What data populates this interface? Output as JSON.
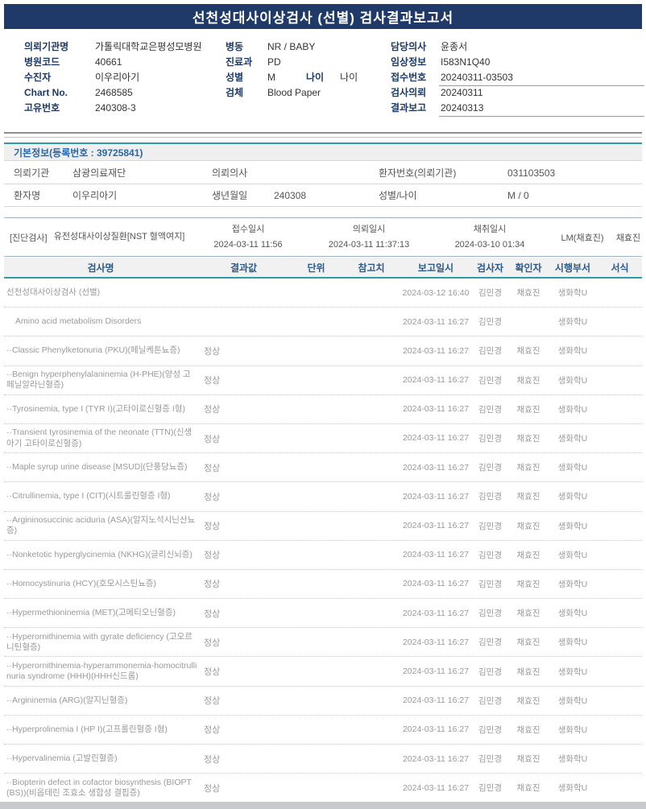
{
  "title": "선천성대사이상검사 (선별) 검사결과보고서",
  "patient_header": {
    "col1": [
      {
        "label": "의뢰기관명",
        "value": "가톨릭대학교은평성모병원"
      },
      {
        "label": "병원코드",
        "value": "40661"
      },
      {
        "label": "수진자",
        "value": "이우리아기"
      },
      {
        "label": "Chart No.",
        "value": "2468585"
      },
      {
        "label": "고유번호",
        "value": "240308-3"
      }
    ],
    "col2": [
      {
        "label": "병동",
        "value": "NR / BABY"
      },
      {
        "label": "진료과",
        "value": "PD"
      },
      {
        "label": "성별",
        "value": "M",
        "label2": "나이",
        "value2": "나이"
      },
      {
        "label": "검체",
        "value": "Blood Paper"
      }
    ],
    "col3": [
      {
        "label": "담당의사",
        "value": "윤종서"
      },
      {
        "label": "임상정보",
        "value": "I583N1Q40"
      },
      {
        "label": "접수번호",
        "value": "20240311-03503",
        "underline": true
      },
      {
        "label": "검사의뢰",
        "value": "20240311"
      },
      {
        "label": "결과보고",
        "value": "20240313",
        "underline": true
      }
    ]
  },
  "basic_info": {
    "header": "기본정보(등록번호 : 39725841)",
    "rows": [
      [
        {
          "label": "의뢰기관",
          "value": "삼광의료재단"
        },
        {
          "label": "의뢰의사",
          "value": ""
        },
        {
          "label": "환자번호(의뢰기관)",
          "value": "031103503"
        }
      ],
      [
        {
          "label": "환자명",
          "value": "이우리아기"
        },
        {
          "label": "생년월일",
          "value": "240308"
        },
        {
          "label": "성별/나이",
          "value": "M / 0"
        }
      ]
    ]
  },
  "diagnosis": {
    "category": "[진단검사]",
    "test_name": "유전성대사이상질환[NST 혈액여지]",
    "times": [
      {
        "label": "접수일시",
        "value": "2024-03-11 11:56"
      },
      {
        "label": "의뢰일시",
        "value": "2024-03-11 11:37:13"
      },
      {
        "label": "채취일시",
        "value": "2024-03-10 01:34"
      }
    ],
    "lm": "LM(채효진)",
    "collector": "채효진"
  },
  "results_table": {
    "headers": [
      "검사명",
      "결과값",
      "단위",
      "참고치",
      "보고일시",
      "검사자",
      "확인자",
      "시행부서",
      "서식"
    ],
    "rows": [
      {
        "name": "선천성대사이상검사 (선별)",
        "result": "",
        "unit": "",
        "ref": "",
        "reported": "2024-03-12 16:40",
        "tester": "김민경",
        "confirmer": "채효진",
        "dept": "생화학U",
        "form": "",
        "indent": 0
      },
      {
        "name": "Amino acid metabolism Disorders",
        "result": "",
        "unit": "",
        "ref": "",
        "reported": "2024-03-11 16:27",
        "tester": "김민경",
        "confirmer": "",
        "dept": "생화학U",
        "form": "",
        "indent": 1
      },
      {
        "name": "··Classic Phenylketonuria (PKU)(페닐케톤뇨증)",
        "result": "정상",
        "unit": "",
        "ref": "",
        "reported": "2024-03-11 16:27",
        "tester": "김민경",
        "confirmer": "채효진",
        "dept": "생화학U",
        "form": "",
        "indent": 0
      },
      {
        "name": "··Benign hyperphenylalaninemia (H-PHE)(양성 고페닐알라닌혈증)",
        "result": "정상",
        "unit": "",
        "ref": "",
        "reported": "2024-03-11 16:27",
        "tester": "김민경",
        "confirmer": "채효진",
        "dept": "생화학U",
        "form": "",
        "indent": 0
      },
      {
        "name": "··Tyrosinemia, type I (TYR I)(고타이로신혈증 I형)",
        "result": "정상",
        "unit": "",
        "ref": "",
        "reported": "2024-03-11 16:27",
        "tester": "김민경",
        "confirmer": "채효진",
        "dept": "생화학U",
        "form": "",
        "indent": 0
      },
      {
        "name": "··Transient tyrosinemia of the neonate (TTN)(신생아기 고타이로신혈증)",
        "result": "정상",
        "unit": "",
        "ref": "",
        "reported": "2024-03-11 16:27",
        "tester": "김민경",
        "confirmer": "채효진",
        "dept": "생화학U",
        "form": "",
        "indent": 0
      },
      {
        "name": "··Maple syrup urine disease [MSUD](단풍당뇨증)",
        "result": "정상",
        "unit": "",
        "ref": "",
        "reported": "2024-03-11 16:27",
        "tester": "김민경",
        "confirmer": "채효진",
        "dept": "생화학U",
        "form": "",
        "indent": 0
      },
      {
        "name": "··Citrullinemia, type I (CIT)(시트룰린혈증 I형)",
        "result": "정상",
        "unit": "",
        "ref": "",
        "reported": "2024-03-11 16:27",
        "tester": "김민경",
        "confirmer": "채효진",
        "dept": "생화학U",
        "form": "",
        "indent": 0
      },
      {
        "name": "··Argininosuccinic aciduria (ASA)(알지노석시닌산뇨증)",
        "result": "정상",
        "unit": "",
        "ref": "",
        "reported": "2024-03-11 16:27",
        "tester": "김민경",
        "confirmer": "채효진",
        "dept": "생화학U",
        "form": "",
        "indent": 0
      },
      {
        "name": "··Nonketotic hyperglycinemia (NKHG)(글리신뇌증)",
        "result": "정상",
        "unit": "",
        "ref": "",
        "reported": "2024-03-11 16:27",
        "tester": "김민경",
        "confirmer": "채효진",
        "dept": "생화학U",
        "form": "",
        "indent": 0
      },
      {
        "name": "··Homocystinuria (HCY)(호모시스틴뇨증)",
        "result": "정상",
        "unit": "",
        "ref": "",
        "reported": "2024-03-11 16:27",
        "tester": "김민경",
        "confirmer": "채효진",
        "dept": "생화학U",
        "form": "",
        "indent": 0
      },
      {
        "name": "··Hypermethioninemia (MET)(고메티오닌혈증)",
        "result": "정상",
        "unit": "",
        "ref": "",
        "reported": "2024-03-11 16:27",
        "tester": "김민경",
        "confirmer": "채효진",
        "dept": "생화학U",
        "form": "",
        "indent": 0
      },
      {
        "name": "··Hyperornithinemia with gyrate deficiency (고오르니틴혈증)",
        "result": "정상",
        "unit": "",
        "ref": "",
        "reported": "2024-03-11 16:27",
        "tester": "김민경",
        "confirmer": "채효진",
        "dept": "생화학U",
        "form": "",
        "indent": 0
      },
      {
        "name": "··Hyperornithinemia-hyperammonemia-homocitrullinuria syndrome (HHH)(HHH신드롬)",
        "result": "정상",
        "unit": "",
        "ref": "",
        "reported": "2024-03-11 16:27",
        "tester": "김민경",
        "confirmer": "채효진",
        "dept": "생화학U",
        "form": "",
        "indent": 0
      },
      {
        "name": "··Argininemia (ARG)(알지닌혈증)",
        "result": "정상",
        "unit": "",
        "ref": "",
        "reported": "2024-03-11 16:27",
        "tester": "김민경",
        "confirmer": "채효진",
        "dept": "생화학U",
        "form": "",
        "indent": 0
      },
      {
        "name": "··Hyperprolinemia I (HP I)(고프롤린혈증 I형)",
        "result": "정상",
        "unit": "",
        "ref": "",
        "reported": "2024-03-11 16:27",
        "tester": "김민경",
        "confirmer": "채효진",
        "dept": "생화학U",
        "form": "",
        "indent": 0
      },
      {
        "name": "··Hypervalinemia (고발린혈증)",
        "result": "정상",
        "unit": "",
        "ref": "",
        "reported": "2024-03-11 16:27",
        "tester": "김민경",
        "confirmer": "채효진",
        "dept": "생화학U",
        "form": "",
        "indent": 0
      },
      {
        "name": "··Biopterin defect in cofactor biosynthesis (BIOPT(BS))(비옵테린 조효소 생합성 결핍증)",
        "result": "정상",
        "unit": "",
        "ref": "",
        "reported": "2024-03-11 16:27",
        "tester": "김민경",
        "confirmer": "채효진",
        "dept": "생화학U",
        "form": "",
        "indent": 0
      }
    ]
  }
}
